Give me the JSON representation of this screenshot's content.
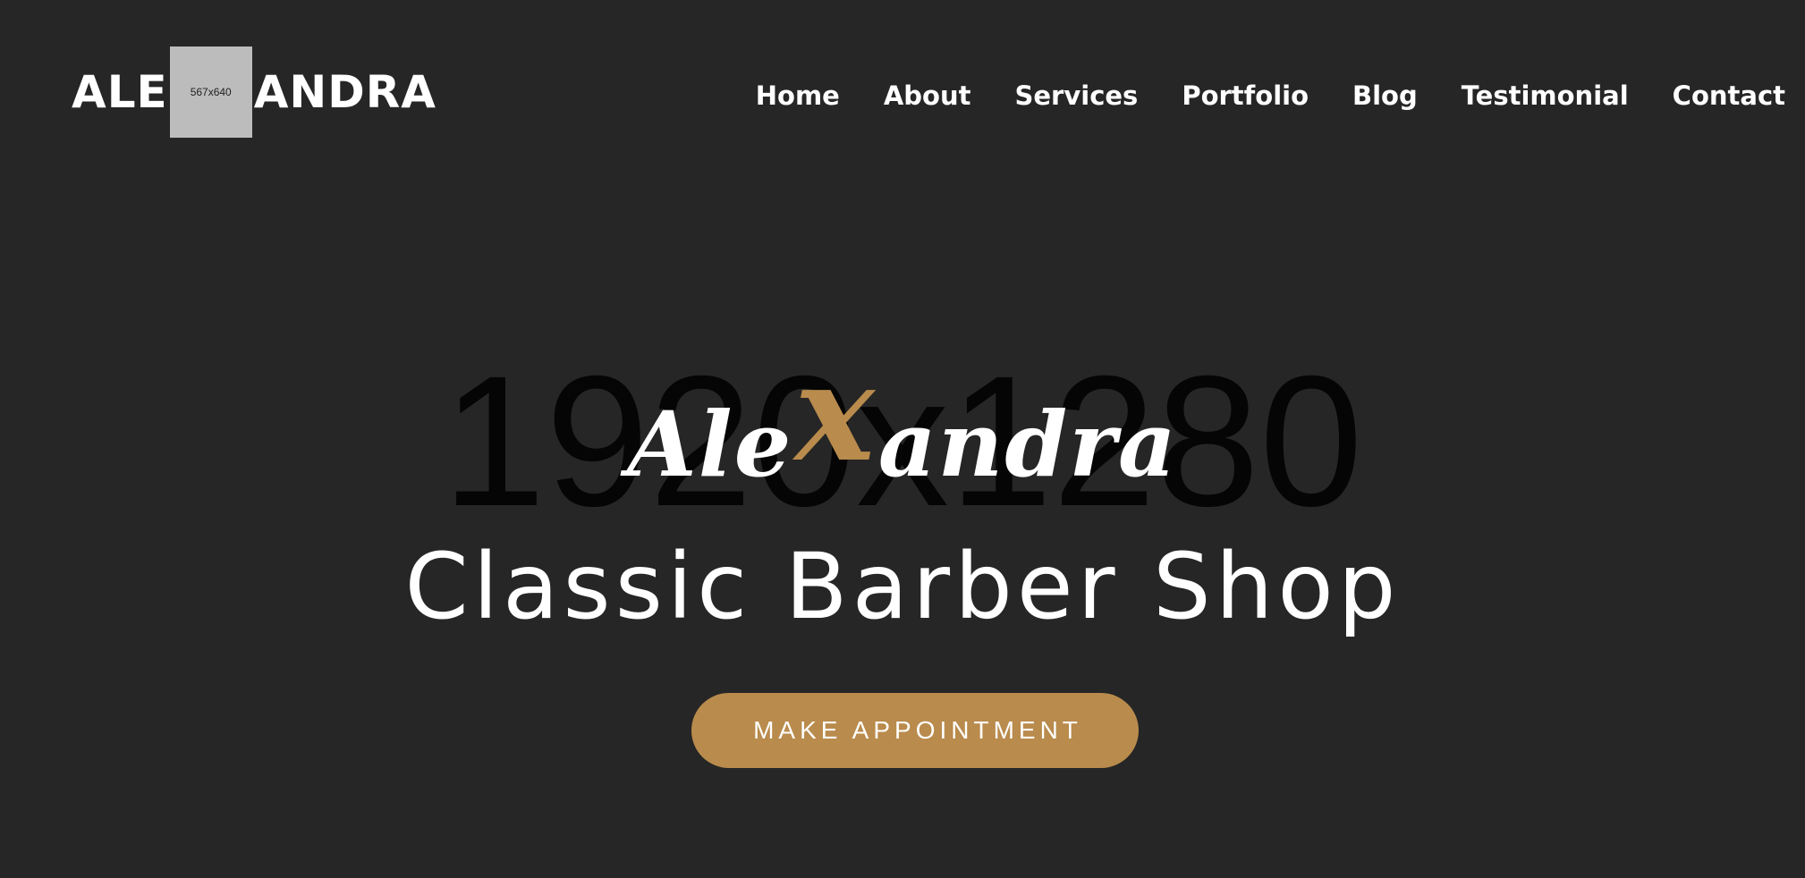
{
  "header": {
    "logo": {
      "left_text": "ALE",
      "placeholder_text": "567x640",
      "right_text": "ANDRA"
    },
    "nav": [
      {
        "label": "Home"
      },
      {
        "label": "About"
      },
      {
        "label": "Services"
      },
      {
        "label": "Portfolio"
      },
      {
        "label": "Blog"
      },
      {
        "label": "Testimonial"
      },
      {
        "label": "Contact"
      }
    ]
  },
  "hero": {
    "background_placeholder_text": "1920x1280",
    "brand": {
      "prefix": "Ale",
      "accent_letter": "x",
      "suffix": "andra"
    },
    "subtitle": "Classic Barber Shop",
    "cta_label": "MAKE APPOINTMENT"
  },
  "colors": {
    "background": "#262626",
    "accent": "#b98b4c",
    "text": "#ffffff",
    "placeholder": "#bcbcbc"
  }
}
